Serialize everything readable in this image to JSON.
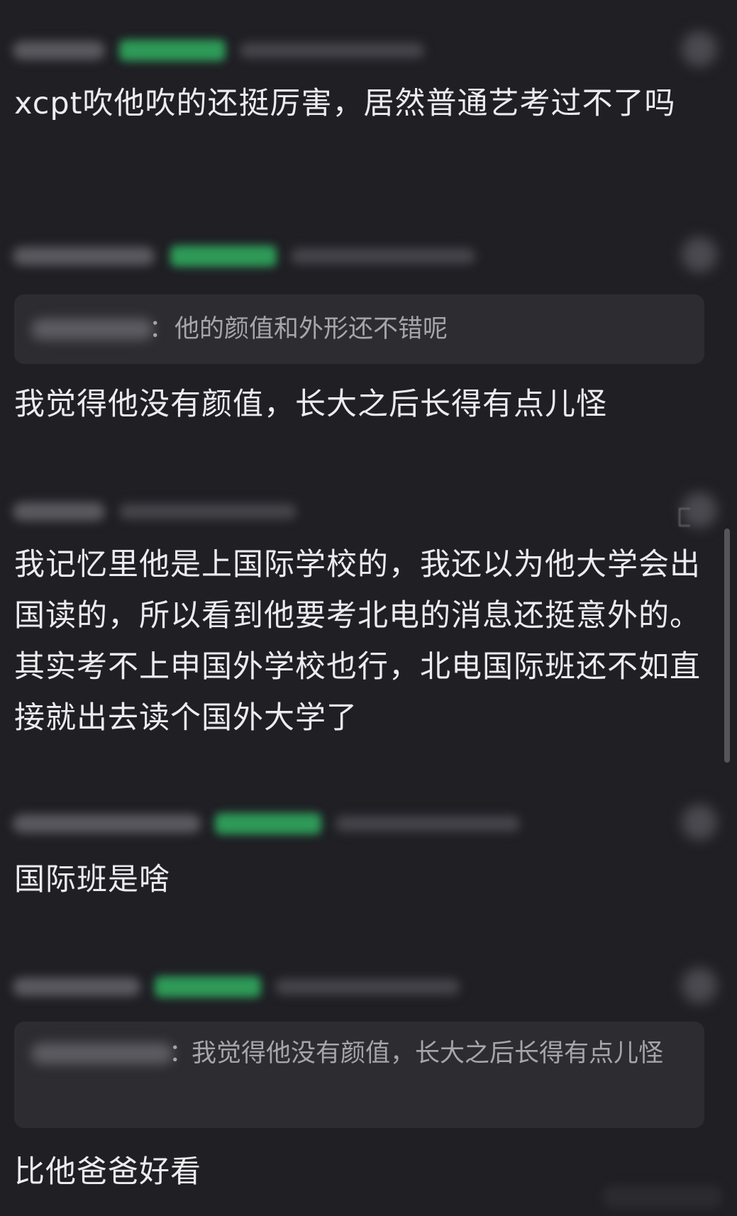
{
  "comments": [
    {
      "text": "xcpt吹他吹的还挺厉害，居然普通艺考过不了吗"
    },
    {
      "quote": {
        "separator": "：",
        "text": "他的颜值和外形还不错呢"
      },
      "text": "我觉得他没有颜值，长大之后长得有点儿怪"
    },
    {
      "text": "我记忆里他是上国际学校的，我还以为他大学会出国读的，所以看到他要考北电的消息还挺意外的。其实考不上申国外学校也行，北电国际班还不如直接就出去读个国外大学了"
    },
    {
      "text": "国际班是啥"
    },
    {
      "quote": {
        "separator": "：",
        "text": "我觉得他没有颜值，长大之后长得有点儿怪"
      },
      "text": "比他爸爸好看"
    }
  ],
  "colors": {
    "background": "#1f1f24",
    "text": "#ececee",
    "quote_background": "#2c2c31",
    "quote_text": "#a5a5ab",
    "badge": "#2e9a58"
  }
}
